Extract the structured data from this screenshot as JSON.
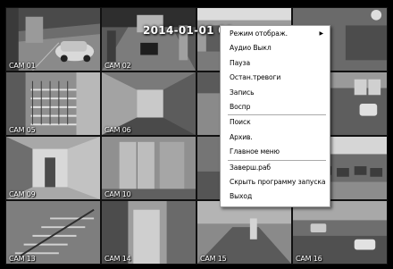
{
  "timestamp": "2014-01-01 01",
  "cameras": [
    {
      "label": "CAM 01"
    },
    {
      "label": "CAM 02"
    },
    {
      "label": ""
    },
    {
      "label": ""
    },
    {
      "label": "CAM 05"
    },
    {
      "label": "CAM 06"
    },
    {
      "label": ""
    },
    {
      "label": ""
    },
    {
      "label": "CAM 09"
    },
    {
      "label": "CAM 10"
    },
    {
      "label": ""
    },
    {
      "label": ""
    },
    {
      "label": "CAM 13"
    },
    {
      "label": "CAM 14"
    },
    {
      "label": "CAM 15"
    },
    {
      "label": "CAM 16"
    }
  ],
  "context_menu": {
    "items": [
      {
        "label": "Режим отображ.",
        "submenu_arrow": "▶"
      },
      {
        "label": "Аудио Выкл"
      },
      {
        "label": "Пауза"
      },
      {
        "label": "Остан.тревоги"
      },
      {
        "label": "Запись"
      },
      {
        "label": "Воспр"
      },
      {
        "label": "Поиск"
      },
      {
        "label": "Архив."
      },
      {
        "label": "Главное меню"
      },
      {
        "label": "Заверш.раб"
      },
      {
        "label": "Скрыть программу запуска"
      },
      {
        "label": "Выход"
      }
    ]
  },
  "colors": {
    "menu_background": "#ffffff",
    "menu_text": "#000000",
    "label_text": "#ffffff",
    "screen_background": "#000000"
  }
}
